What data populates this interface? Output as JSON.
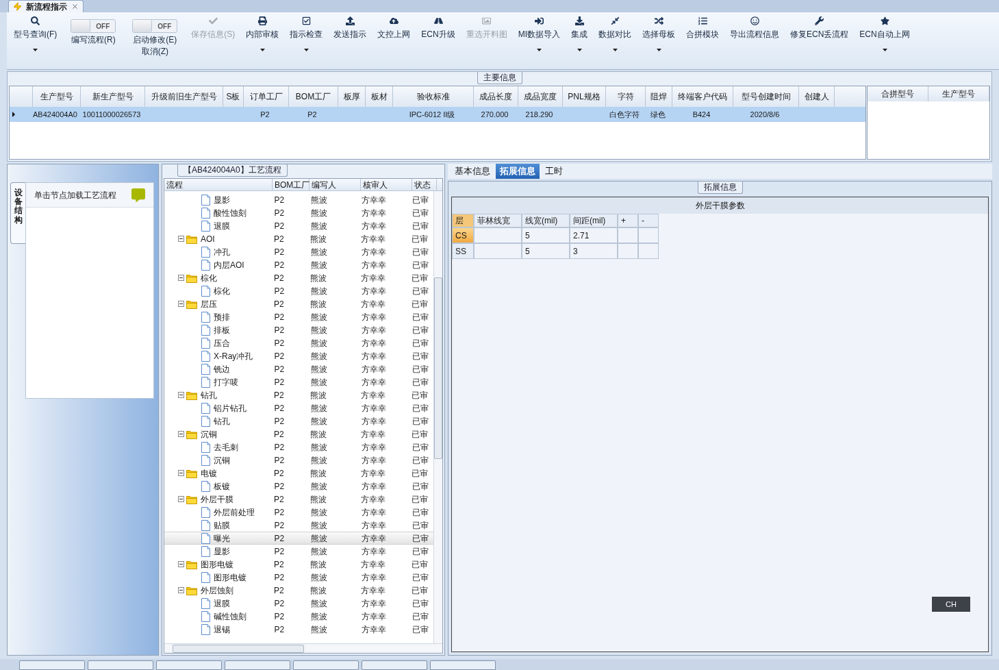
{
  "document_tab": {
    "title": "新流程指示"
  },
  "toolbar": [
    {
      "kind": "button",
      "lines": [
        "型号查询(F)"
      ],
      "dropdown": true,
      "disabled": false
    },
    {
      "kind": "toggle",
      "text": "OFF",
      "on": false,
      "lines": [
        "编写流程(R)"
      ]
    },
    {
      "kind": "toggle",
      "text": "OFF",
      "on": false,
      "lines": [
        "启动修改(E)",
        "取消(Z)"
      ]
    },
    {
      "kind": "button",
      "lines": [
        "保存信息(S)"
      ],
      "dropdown": false,
      "disabled": true
    },
    {
      "kind": "button",
      "lines": [
        "内部审核"
      ],
      "dropdown": true,
      "disabled": false
    },
    {
      "kind": "button",
      "lines": [
        "指示检查"
      ],
      "dropdown": true,
      "disabled": false
    },
    {
      "kind": "button",
      "lines": [
        "发送指示"
      ],
      "dropdown": false,
      "disabled": false
    },
    {
      "kind": "button",
      "lines": [
        "文控上网"
      ],
      "dropdown": false,
      "disabled": false
    },
    {
      "kind": "button",
      "lines": [
        "ECN升级"
      ],
      "dropdown": false,
      "disabled": false
    },
    {
      "kind": "button",
      "lines": [
        "重选开料图"
      ],
      "dropdown": false,
      "disabled": true
    },
    {
      "kind": "button",
      "lines": [
        "MI数据导入"
      ],
      "dropdown": true,
      "disabled": false
    },
    {
      "kind": "button",
      "lines": [
        "集成"
      ],
      "dropdown": true,
      "disabled": false
    },
    {
      "kind": "button",
      "lines": [
        "数据对比"
      ],
      "dropdown": true,
      "disabled": false
    },
    {
      "kind": "button",
      "lines": [
        "选择母板"
      ],
      "dropdown": true,
      "disabled": false
    },
    {
      "kind": "button",
      "lines": [
        "合拼模块"
      ],
      "dropdown": false,
      "disabled": false
    },
    {
      "kind": "button",
      "lines": [
        "导出流程信息"
      ],
      "dropdown": false,
      "disabled": false
    },
    {
      "kind": "button",
      "lines": [
        "修复ECN丢流程"
      ],
      "dropdown": false,
      "disabled": false
    },
    {
      "kind": "button",
      "lines": [
        "ECN自动上网"
      ],
      "dropdown": true,
      "disabled": false
    }
  ],
  "main_info": {
    "title": "主要信息",
    "columns": [
      "生产型号",
      "新生产型号",
      "升级前旧生产型号",
      "S板",
      "订单工厂",
      "BOM工厂",
      "板厚",
      "板材",
      "验收标准",
      "成品长度",
      "成品宽度",
      "PNL规格",
      "字符",
      "阻焊",
      "终端客户代码",
      "型号创建时间",
      "创建人"
    ],
    "rows": [
      {
        "selected": true,
        "cells": [
          "AB424004A0",
          "10011000026573",
          "",
          "",
          "P2",
          "P2",
          "",
          "",
          "IPC-6012 II级",
          "270.000",
          "218.290",
          "",
          "白色字符",
          "绿色",
          "B424",
          "2020/8/6",
          ""
        ]
      }
    ],
    "side_columns": [
      "合拼型号",
      "生产型号"
    ]
  },
  "left_panel": {
    "vertical_tab": "设备结构",
    "items": [
      "单击节点加载工艺流程"
    ]
  },
  "process": {
    "title": "【AB424004A0】工艺流程",
    "columns": [
      "流程",
      "BOM工厂",
      "编写人",
      "核审人",
      "状态"
    ],
    "tree": [
      {
        "expanded": true,
        "children": [
          {
            "label": "显影",
            "bom": "P2",
            "writer": "熊波",
            "reviewer": "方幸幸",
            "status": "已审",
            "selected": false
          },
          {
            "label": "酸性蚀刻",
            "bom": "P2",
            "writer": "熊波",
            "reviewer": "方幸幸",
            "status": "已审",
            "selected": false
          },
          {
            "label": "退膜",
            "bom": "P2",
            "writer": "熊波",
            "reviewer": "方幸幸",
            "status": "已审",
            "selected": false
          }
        ]
      },
      {
        "label": "AOI",
        "bom": "P2",
        "writer": "熊波",
        "reviewer": "方幸幸",
        "status": "已审",
        "expanded": true,
        "children": [
          {
            "label": "冲孔",
            "bom": "P2",
            "writer": "熊波",
            "reviewer": "方幸幸",
            "status": "已审",
            "selected": false
          },
          {
            "label": "内层AOI",
            "bom": "P2",
            "writer": "熊波",
            "reviewer": "方幸幸",
            "status": "已审",
            "selected": false
          }
        ]
      },
      {
        "label": "棕化",
        "bom": "P2",
        "writer": "熊波",
        "reviewer": "方幸幸",
        "status": "已审",
        "expanded": true,
        "children": [
          {
            "label": "棕化",
            "bom": "P2",
            "writer": "熊波",
            "reviewer": "方幸幸",
            "status": "已审",
            "selected": false
          }
        ]
      },
      {
        "label": "层压",
        "bom": "P2",
        "writer": "熊波",
        "reviewer": "方幸幸",
        "status": "已审",
        "expanded": true,
        "children": [
          {
            "label": "预排",
            "bom": "P2",
            "writer": "熊波",
            "reviewer": "方幸幸",
            "status": "已审",
            "selected": false
          },
          {
            "label": "排板",
            "bom": "P2",
            "writer": "熊波",
            "reviewer": "方幸幸",
            "status": "已审",
            "selected": false
          },
          {
            "label": "压合",
            "bom": "P2",
            "writer": "熊波",
            "reviewer": "方幸幸",
            "status": "已审",
            "selected": false
          },
          {
            "label": "X-Ray冲孔",
            "bom": "P2",
            "writer": "熊波",
            "reviewer": "方幸幸",
            "status": "已审",
            "selected": false
          },
          {
            "label": "铣边",
            "bom": "P2",
            "writer": "熊波",
            "reviewer": "方幸幸",
            "status": "已审",
            "selected": false
          },
          {
            "label": "打字唛",
            "bom": "P2",
            "writer": "熊波",
            "reviewer": "方幸幸",
            "status": "已审",
            "selected": false
          }
        ]
      },
      {
        "label": "钻孔",
        "bom": "P2",
        "writer": "熊波",
        "reviewer": "方幸幸",
        "status": "已审",
        "expanded": true,
        "children": [
          {
            "label": "铝片钻孔",
            "bom": "P2",
            "writer": "熊波",
            "reviewer": "方幸幸",
            "status": "已审",
            "selected": false
          },
          {
            "label": "钻孔",
            "bom": "P2",
            "writer": "熊波",
            "reviewer": "方幸幸",
            "status": "已审",
            "selected": false
          }
        ]
      },
      {
        "label": "沉铜",
        "bom": "P2",
        "writer": "熊波",
        "reviewer": "方幸幸",
        "status": "已审",
        "expanded": true,
        "children": [
          {
            "label": "去毛刺",
            "bom": "P2",
            "writer": "熊波",
            "reviewer": "方幸幸",
            "status": "已审",
            "selected": false
          },
          {
            "label": "沉铜",
            "bom": "P2",
            "writer": "熊波",
            "reviewer": "方幸幸",
            "status": "已审",
            "selected": false
          }
        ]
      },
      {
        "label": "电镀",
        "bom": "P2",
        "writer": "熊波",
        "reviewer": "方幸幸",
        "status": "已审",
        "expanded": true,
        "children": [
          {
            "label": "板镀",
            "bom": "P2",
            "writer": "熊波",
            "reviewer": "方幸幸",
            "status": "已审",
            "selected": false
          }
        ]
      },
      {
        "label": "外层干膜",
        "bom": "P2",
        "writer": "熊波",
        "reviewer": "方幸幸",
        "status": "已审",
        "expanded": true,
        "children": [
          {
            "label": "外层前处理",
            "bom": "P2",
            "writer": "熊波",
            "reviewer": "方幸幸",
            "status": "已审",
            "selected": false
          },
          {
            "label": "贴膜",
            "bom": "P2",
            "writer": "熊波",
            "reviewer": "方幸幸",
            "status": "已审",
            "selected": false
          },
          {
            "label": "曝光",
            "bom": "P2",
            "writer": "熊波",
            "reviewer": "方幸幸",
            "status": "已审",
            "selected": true
          },
          {
            "label": "显影",
            "bom": "P2",
            "writer": "熊波",
            "reviewer": "方幸幸",
            "status": "已审",
            "selected": false
          }
        ]
      },
      {
        "label": "图形电镀",
        "bom": "P2",
        "writer": "熊波",
        "reviewer": "方幸幸",
        "status": "已审",
        "expanded": true,
        "children": [
          {
            "label": "图形电镀",
            "bom": "P2",
            "writer": "熊波",
            "reviewer": "方幸幸",
            "status": "已审",
            "selected": false
          }
        ]
      },
      {
        "label": "外层蚀刻",
        "bom": "P2",
        "writer": "熊波",
        "reviewer": "方幸幸",
        "status": "已审",
        "expanded": true,
        "children": [
          {
            "label": "退膜",
            "bom": "P2",
            "writer": "熊波",
            "reviewer": "方幸幸",
            "status": "已审",
            "selected": false
          },
          {
            "label": "碱性蚀刻",
            "bom": "P2",
            "writer": "熊波",
            "reviewer": "方幸幸",
            "status": "已审",
            "selected": false
          },
          {
            "label": "退锡",
            "bom": "P2",
            "writer": "熊波",
            "reviewer": "方幸幸",
            "status": "已审",
            "selected": false
          }
        ]
      }
    ]
  },
  "detail_tabs": [
    {
      "label": "基本信息",
      "selected": false
    },
    {
      "label": "拓展信息",
      "selected": true
    },
    {
      "label": "工时",
      "selected": false
    }
  ],
  "extended": {
    "title": "拓展信息",
    "table_title": "外层干膜参数",
    "columns": [
      "层",
      "菲林线宽",
      "线宽(mil)",
      "间距(mil)",
      "+",
      "-"
    ],
    "rows": [
      {
        "selected": true,
        "cells": [
          "CS",
          "",
          "5",
          "2.71",
          "",
          ""
        ]
      },
      {
        "selected": false,
        "cells": [
          "SS",
          "",
          "5",
          "3",
          "",
          ""
        ]
      }
    ]
  },
  "ime": {
    "text": "CH"
  }
}
